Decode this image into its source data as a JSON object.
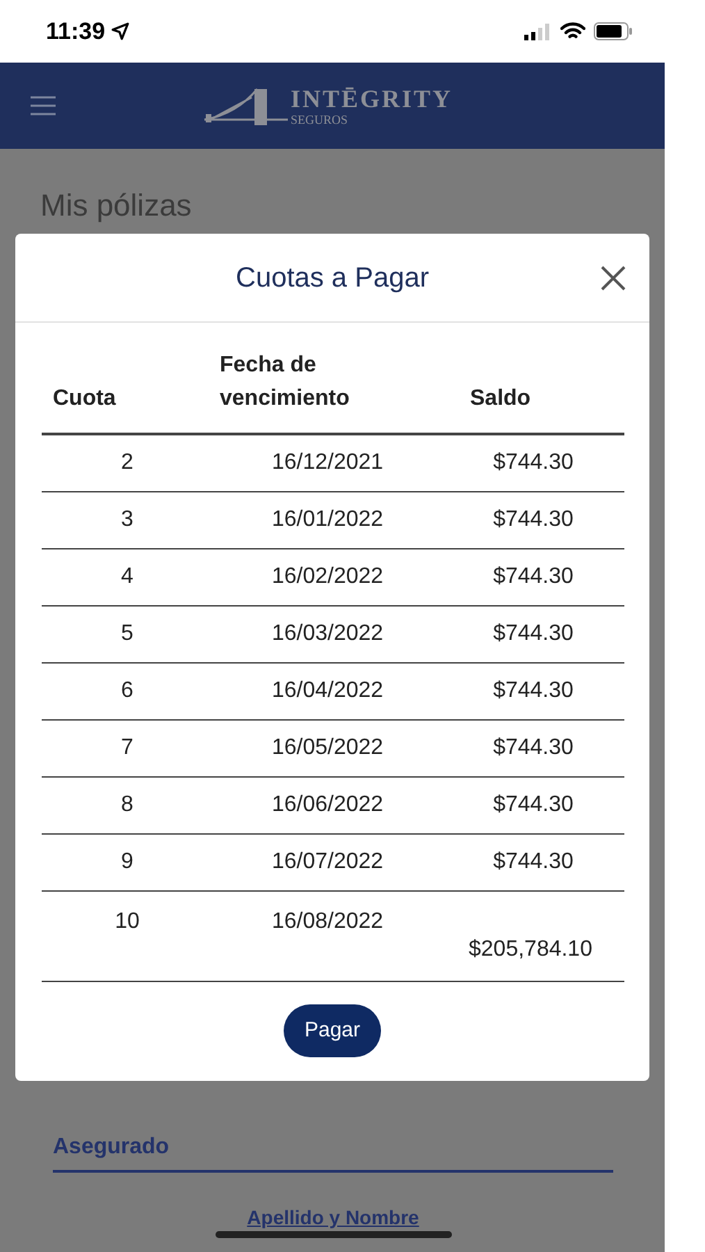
{
  "status_bar": {
    "time": "11:39"
  },
  "header": {
    "brand": "INTĒGRITY",
    "brand_sub": "SEGUROS"
  },
  "page": {
    "title": "Mis pólizas",
    "section": "Asegurado",
    "field_label": "Apellido y Nombre"
  },
  "modal": {
    "title": "Cuotas a Pagar",
    "columns": [
      "Cuota",
      "Fecha de vencimiento",
      "Saldo"
    ],
    "rows": [
      {
        "cuota": "2",
        "fecha": "16/12/2021",
        "saldo": "$744.30"
      },
      {
        "cuota": "3",
        "fecha": "16/01/2022",
        "saldo": "$744.30"
      },
      {
        "cuota": "4",
        "fecha": "16/02/2022",
        "saldo": "$744.30"
      },
      {
        "cuota": "5",
        "fecha": "16/03/2022",
        "saldo": "$744.30"
      },
      {
        "cuota": "6",
        "fecha": "16/04/2022",
        "saldo": "$744.30"
      },
      {
        "cuota": "7",
        "fecha": "16/05/2022",
        "saldo": "$744.30"
      },
      {
        "cuota": "8",
        "fecha": "16/06/2022",
        "saldo": "$744.30"
      },
      {
        "cuota": "9",
        "fecha": "16/07/2022",
        "saldo": "$744.30"
      },
      {
        "cuota": "10",
        "fecha": "16/08/2022",
        "saldo": "$205,784.10"
      }
    ],
    "button": "Pagar"
  }
}
